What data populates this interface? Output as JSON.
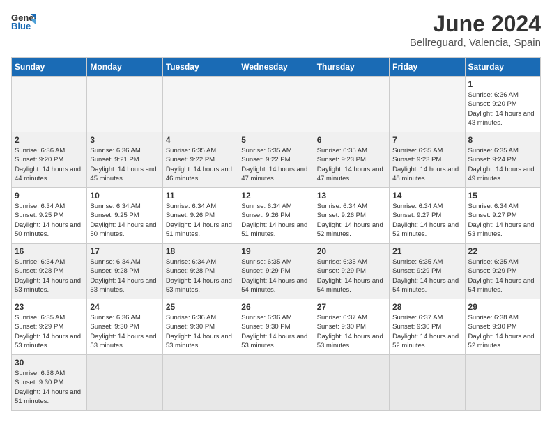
{
  "logo": {
    "text_general": "General",
    "text_blue": "Blue"
  },
  "header": {
    "month_year": "June 2024",
    "location": "Bellreguard, Valencia, Spain"
  },
  "days_of_week": [
    "Sunday",
    "Monday",
    "Tuesday",
    "Wednesday",
    "Thursday",
    "Friday",
    "Saturday"
  ],
  "weeks": [
    [
      {
        "day": "",
        "empty": true
      },
      {
        "day": "",
        "empty": true
      },
      {
        "day": "",
        "empty": true
      },
      {
        "day": "",
        "empty": true
      },
      {
        "day": "",
        "empty": true
      },
      {
        "day": "",
        "empty": true
      },
      {
        "day": "1",
        "sunrise": "Sunrise: 6:36 AM",
        "sunset": "Sunset: 9:20 PM",
        "daylight": "Daylight: 14 hours and 43 minutes."
      }
    ],
    [
      {
        "day": "2",
        "sunrise": "Sunrise: 6:36 AM",
        "sunset": "Sunset: 9:20 PM",
        "daylight": "Daylight: 14 hours and 44 minutes."
      },
      {
        "day": "3",
        "sunrise": "Sunrise: 6:36 AM",
        "sunset": "Sunset: 9:21 PM",
        "daylight": "Daylight: 14 hours and 45 minutes."
      },
      {
        "day": "4",
        "sunrise": "Sunrise: 6:35 AM",
        "sunset": "Sunset: 9:22 PM",
        "daylight": "Daylight: 14 hours and 46 minutes."
      },
      {
        "day": "5",
        "sunrise": "Sunrise: 6:35 AM",
        "sunset": "Sunset: 9:22 PM",
        "daylight": "Daylight: 14 hours and 47 minutes."
      },
      {
        "day": "6",
        "sunrise": "Sunrise: 6:35 AM",
        "sunset": "Sunset: 9:23 PM",
        "daylight": "Daylight: 14 hours and 47 minutes."
      },
      {
        "day": "7",
        "sunrise": "Sunrise: 6:35 AM",
        "sunset": "Sunset: 9:23 PM",
        "daylight": "Daylight: 14 hours and 48 minutes."
      },
      {
        "day": "8",
        "sunrise": "Sunrise: 6:35 AM",
        "sunset": "Sunset: 9:24 PM",
        "daylight": "Daylight: 14 hours and 49 minutes."
      }
    ],
    [
      {
        "day": "9",
        "sunrise": "Sunrise: 6:34 AM",
        "sunset": "Sunset: 9:25 PM",
        "daylight": "Daylight: 14 hours and 50 minutes."
      },
      {
        "day": "10",
        "sunrise": "Sunrise: 6:34 AM",
        "sunset": "Sunset: 9:25 PM",
        "daylight": "Daylight: 14 hours and 50 minutes."
      },
      {
        "day": "11",
        "sunrise": "Sunrise: 6:34 AM",
        "sunset": "Sunset: 9:26 PM",
        "daylight": "Daylight: 14 hours and 51 minutes."
      },
      {
        "day": "12",
        "sunrise": "Sunrise: 6:34 AM",
        "sunset": "Sunset: 9:26 PM",
        "daylight": "Daylight: 14 hours and 51 minutes."
      },
      {
        "day": "13",
        "sunrise": "Sunrise: 6:34 AM",
        "sunset": "Sunset: 9:26 PM",
        "daylight": "Daylight: 14 hours and 52 minutes."
      },
      {
        "day": "14",
        "sunrise": "Sunrise: 6:34 AM",
        "sunset": "Sunset: 9:27 PM",
        "daylight": "Daylight: 14 hours and 52 minutes."
      },
      {
        "day": "15",
        "sunrise": "Sunrise: 6:34 AM",
        "sunset": "Sunset: 9:27 PM",
        "daylight": "Daylight: 14 hours and 53 minutes."
      }
    ],
    [
      {
        "day": "16",
        "sunrise": "Sunrise: 6:34 AM",
        "sunset": "Sunset: 9:28 PM",
        "daylight": "Daylight: 14 hours and 53 minutes."
      },
      {
        "day": "17",
        "sunrise": "Sunrise: 6:34 AM",
        "sunset": "Sunset: 9:28 PM",
        "daylight": "Daylight: 14 hours and 53 minutes."
      },
      {
        "day": "18",
        "sunrise": "Sunrise: 6:34 AM",
        "sunset": "Sunset: 9:28 PM",
        "daylight": "Daylight: 14 hours and 53 minutes."
      },
      {
        "day": "19",
        "sunrise": "Sunrise: 6:35 AM",
        "sunset": "Sunset: 9:29 PM",
        "daylight": "Daylight: 14 hours and 54 minutes."
      },
      {
        "day": "20",
        "sunrise": "Sunrise: 6:35 AM",
        "sunset": "Sunset: 9:29 PM",
        "daylight": "Daylight: 14 hours and 54 minutes."
      },
      {
        "day": "21",
        "sunrise": "Sunrise: 6:35 AM",
        "sunset": "Sunset: 9:29 PM",
        "daylight": "Daylight: 14 hours and 54 minutes."
      },
      {
        "day": "22",
        "sunrise": "Sunrise: 6:35 AM",
        "sunset": "Sunset: 9:29 PM",
        "daylight": "Daylight: 14 hours and 54 minutes."
      }
    ],
    [
      {
        "day": "23",
        "sunrise": "Sunrise: 6:35 AM",
        "sunset": "Sunset: 9:29 PM",
        "daylight": "Daylight: 14 hours and 53 minutes."
      },
      {
        "day": "24",
        "sunrise": "Sunrise: 6:36 AM",
        "sunset": "Sunset: 9:30 PM",
        "daylight": "Daylight: 14 hours and 53 minutes."
      },
      {
        "day": "25",
        "sunrise": "Sunrise: 6:36 AM",
        "sunset": "Sunset: 9:30 PM",
        "daylight": "Daylight: 14 hours and 53 minutes."
      },
      {
        "day": "26",
        "sunrise": "Sunrise: 6:36 AM",
        "sunset": "Sunset: 9:30 PM",
        "daylight": "Daylight: 14 hours and 53 minutes."
      },
      {
        "day": "27",
        "sunrise": "Sunrise: 6:37 AM",
        "sunset": "Sunset: 9:30 PM",
        "daylight": "Daylight: 14 hours and 53 minutes."
      },
      {
        "day": "28",
        "sunrise": "Sunrise: 6:37 AM",
        "sunset": "Sunset: 9:30 PM",
        "daylight": "Daylight: 14 hours and 52 minutes."
      },
      {
        "day": "29",
        "sunrise": "Sunrise: 6:38 AM",
        "sunset": "Sunset: 9:30 PM",
        "daylight": "Daylight: 14 hours and 52 minutes."
      }
    ],
    [
      {
        "day": "30",
        "sunrise": "Sunrise: 6:38 AM",
        "sunset": "Sunset: 9:30 PM",
        "daylight": "Daylight: 14 hours and 51 minutes."
      },
      {
        "day": "",
        "empty": true
      },
      {
        "day": "",
        "empty": true
      },
      {
        "day": "",
        "empty": true
      },
      {
        "day": "",
        "empty": true
      },
      {
        "day": "",
        "empty": true
      },
      {
        "day": "",
        "empty": true
      }
    ]
  ]
}
